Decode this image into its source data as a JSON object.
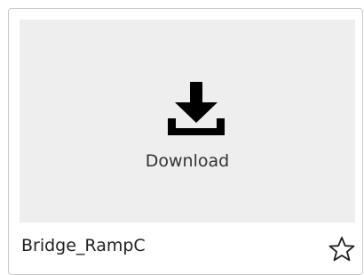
{
  "card": {
    "preview": {
      "action_label": "Download",
      "icon": "download-icon",
      "background_color": "#eeeeee"
    },
    "title": "Bridge_RampC",
    "favorite": {
      "icon": "star-outline-icon",
      "active": false
    }
  }
}
